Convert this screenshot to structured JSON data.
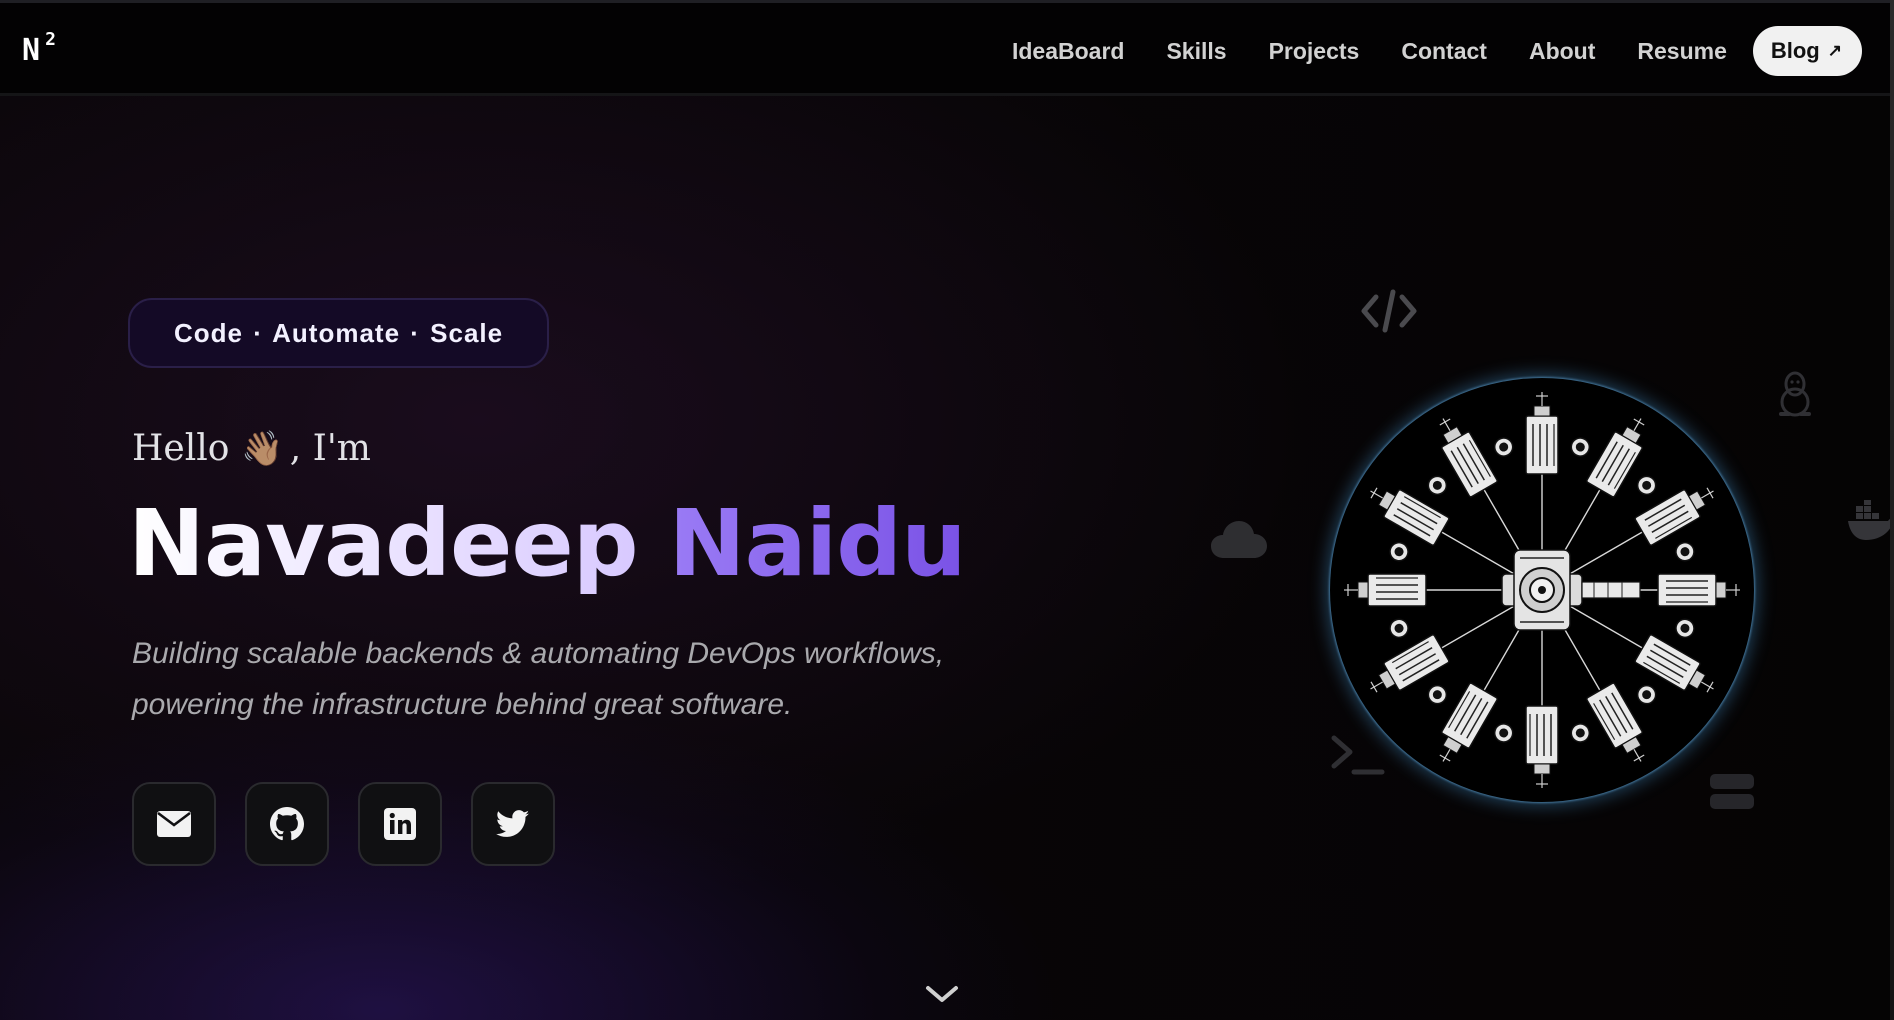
{
  "logo": {
    "main": "N",
    "sup": "2"
  },
  "nav": {
    "links": [
      "IdeaBoard",
      "Skills",
      "Projects",
      "Contact",
      "About",
      "Resume"
    ],
    "blog_label": "Blog",
    "blog_arrow": "↗"
  },
  "hero": {
    "tagline": "Code · Automate · Scale",
    "hello_prefix": "Hello",
    "hello_emoji": "👋🏽",
    "hello_suffix": ", I'm",
    "first_name": "Navadeep",
    "last_name": "Naidu",
    "subtitle_line1": "Building scalable backends & automating DevOps workflows,",
    "subtitle_line2": "powering the infrastructure behind great software.",
    "code_icon_text": "</>"
  },
  "socials": [
    {
      "name": "email",
      "icon": "envelope-icon"
    },
    {
      "name": "github",
      "icon": "github-icon"
    },
    {
      "name": "linkedin",
      "icon": "linkedin-icon"
    },
    {
      "name": "twitter",
      "icon": "twitter-icon"
    }
  ],
  "decorations": [
    "code-icon",
    "cloud-icon",
    "terminal-icon",
    "linux-penguin-icon",
    "docker-icon",
    "server-icon",
    "spaceship-ring-illustration"
  ],
  "colors": {
    "accent_purple": "#8a63f0",
    "background": "#050305",
    "tagline_bg": "#140a26",
    "ring_glow": "#4696d2"
  }
}
